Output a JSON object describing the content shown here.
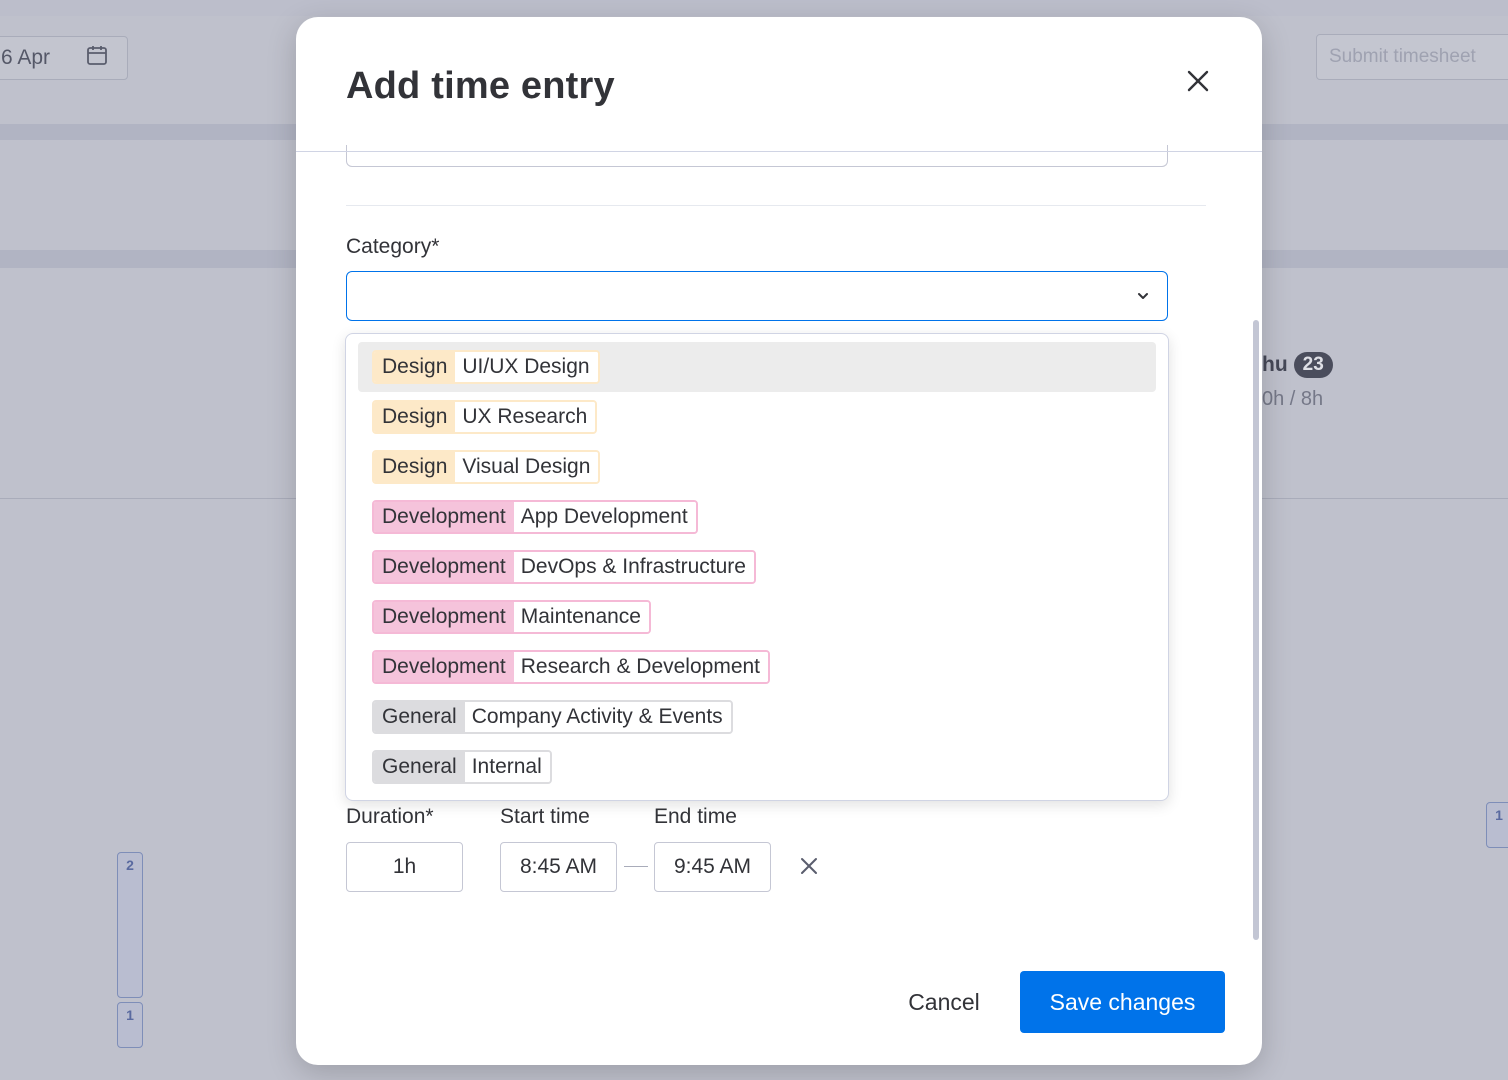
{
  "background": {
    "date_text": "6 Apr",
    "submit_label": "Submit timesheet",
    "day_name": "hu",
    "day_number": "23",
    "day_hours": "0h / 8h",
    "col_badges": [
      "2",
      "1",
      "1"
    ]
  },
  "modal": {
    "title": "Add time entry",
    "category_label": "Category*",
    "category_value": "",
    "options": [
      {
        "category": "Design",
        "sub": "UI/UX Design",
        "kind": "design",
        "hover": true
      },
      {
        "category": "Design",
        "sub": "UX Research",
        "kind": "design"
      },
      {
        "category": "Design",
        "sub": "Visual Design",
        "kind": "design"
      },
      {
        "category": "Development",
        "sub": "App Development",
        "kind": "dev"
      },
      {
        "category": "Development",
        "sub": "DevOps & Infrastructure",
        "kind": "dev"
      },
      {
        "category": "Development",
        "sub": "Maintenance",
        "kind": "dev"
      },
      {
        "category": "Development",
        "sub": "Research & Development",
        "kind": "dev"
      },
      {
        "category": "General",
        "sub": "Company Activity & Events",
        "kind": "gen"
      },
      {
        "category": "General",
        "sub": "Internal",
        "kind": "gen"
      }
    ],
    "duration_label": "Duration*",
    "start_label": "Start time",
    "end_label": "End time",
    "duration_value": "1h",
    "start_value": "8:45 AM",
    "end_value": "9:45 AM",
    "cancel_label": "Cancel",
    "save_label": "Save changes"
  },
  "colors": {
    "accent": "#0073ea",
    "design_tag": "#fde9c8",
    "development_tag": "#f5c3db",
    "general_tag": "#dcdcdf"
  },
  "icons": {
    "close": "close-icon",
    "calendar": "calendar-icon",
    "chevron": "chevron-down-icon",
    "clear": "clear-time-icon"
  }
}
